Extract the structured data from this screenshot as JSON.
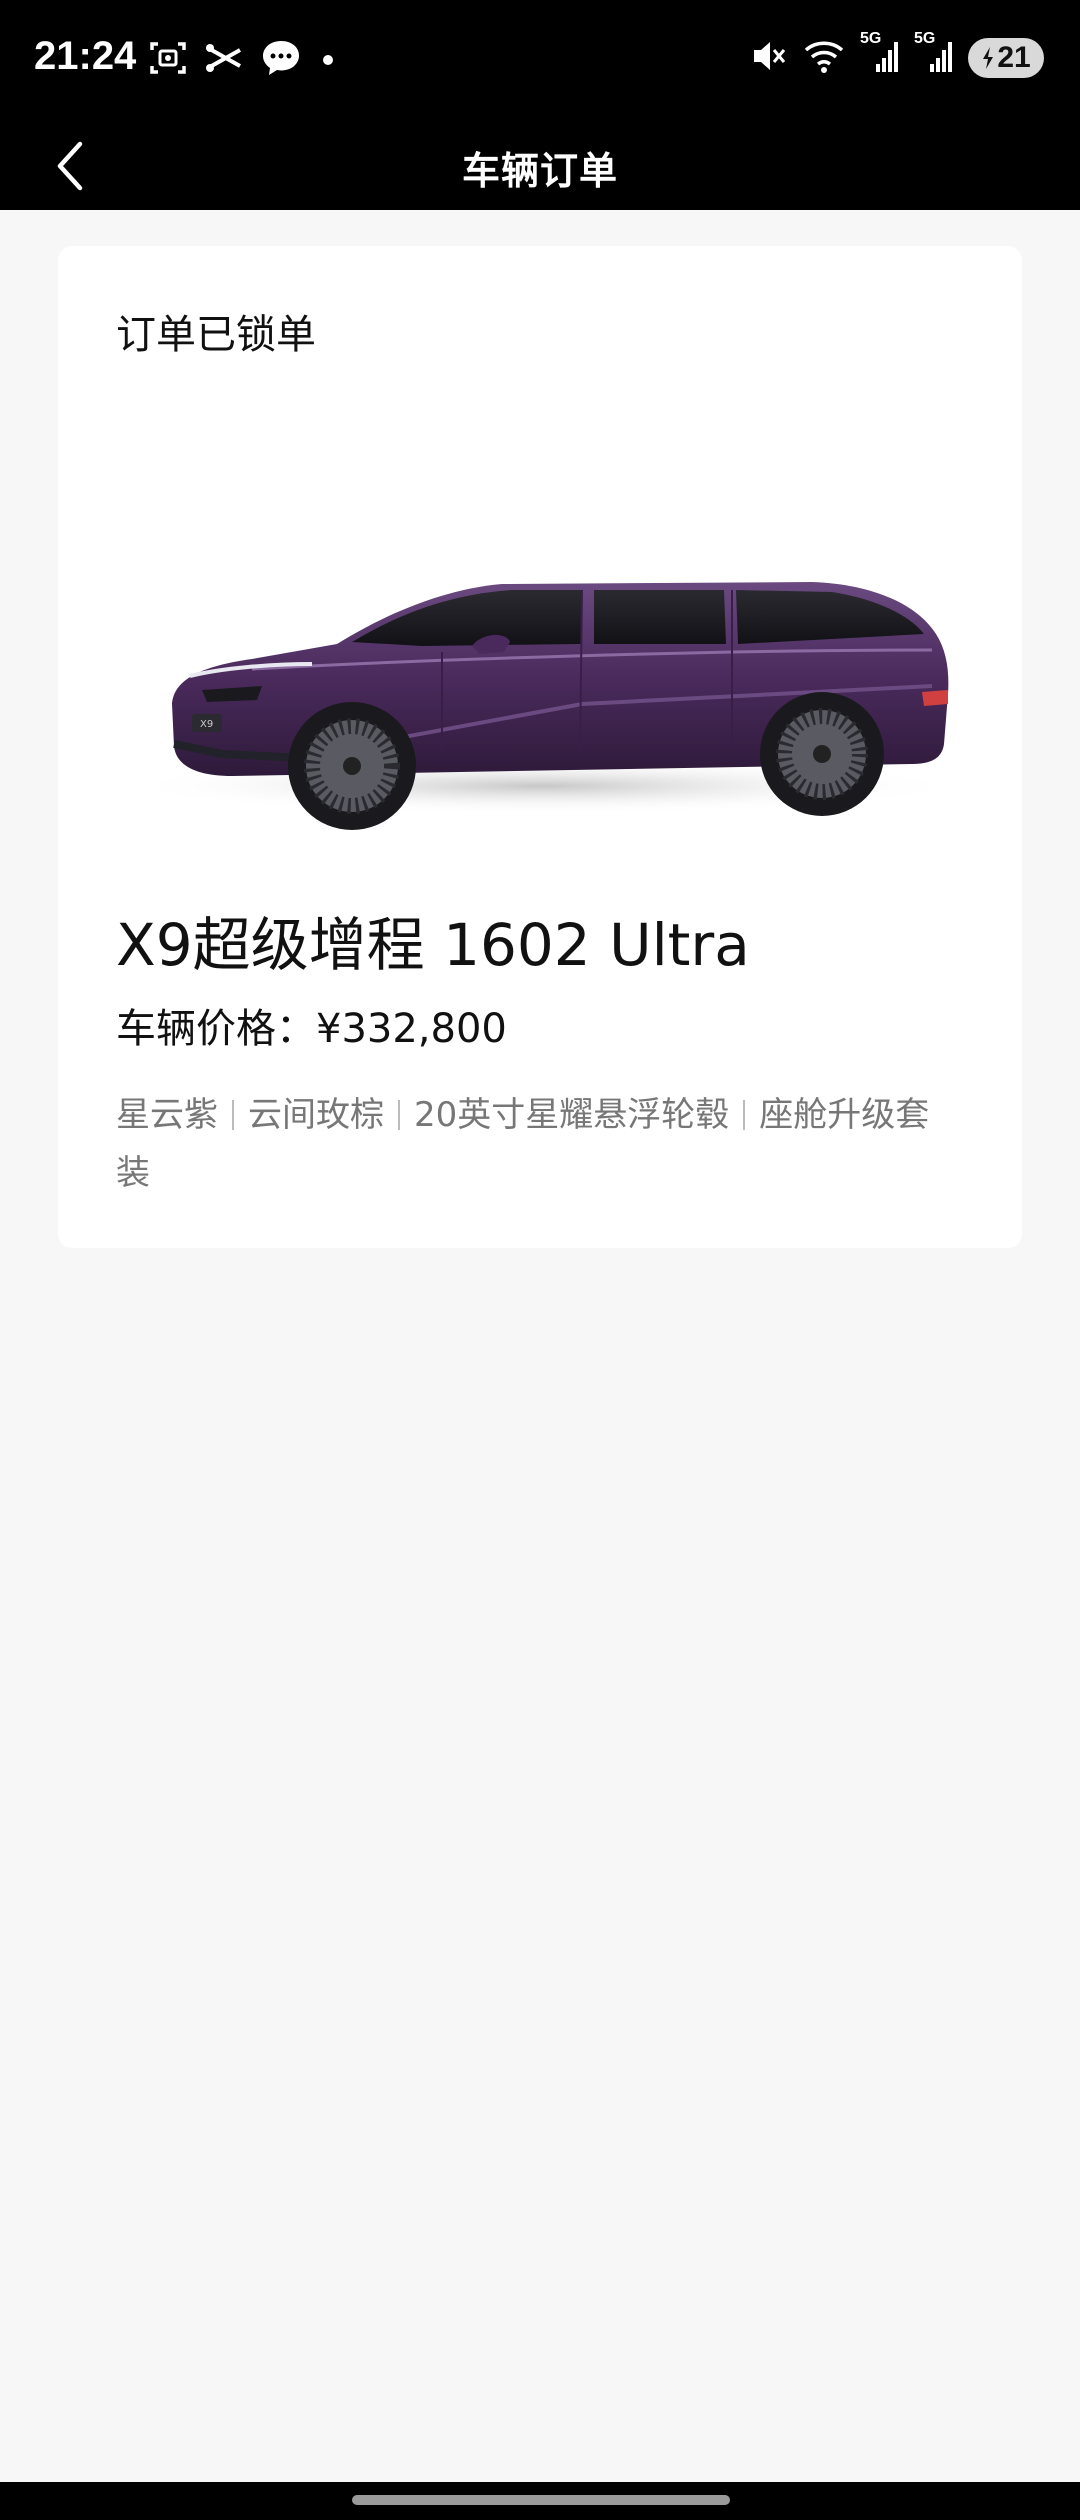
{
  "status_bar": {
    "time": "21:24",
    "battery": "21",
    "network_1": "5G",
    "network_2": "5G",
    "icons": [
      "screenshot-icon",
      "scissors-icon",
      "message-icon",
      "dot-icon",
      "mute-icon",
      "wifi-icon",
      "signal-icon",
      "signal-icon",
      "battery-icon"
    ]
  },
  "nav": {
    "title": "车辆订单",
    "back_icon": "chevron-left-icon"
  },
  "order": {
    "status": "订单已锁单",
    "model": "X9超级增程 1602 Ultra",
    "price": "车辆价格：¥332,800",
    "options": [
      "星云紫",
      "云间玫棕",
      "20英寸星耀悬浮轮毂",
      "座舱升级套"
    ],
    "options_tail": "装",
    "car_color": "#4a2a5c",
    "car_badge": "X9"
  }
}
